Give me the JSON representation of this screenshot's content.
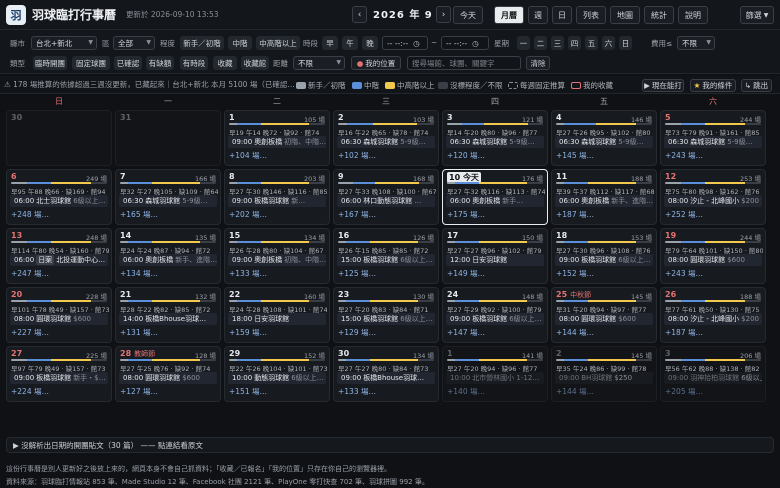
{
  "header": {
    "logo_text": "羽",
    "title": "羽球臨打行事曆",
    "updated": "更新於 2026-09-10 13:53",
    "prev_icon": "‹",
    "next_icon": "›",
    "month_label": "2026 年 9 月",
    "today_label": "今天",
    "views": [
      "月曆",
      "週",
      "日",
      "列表",
      "地圖",
      "統計",
      "說明"
    ],
    "active_view": "月曆",
    "filter_menu": "篩選"
  },
  "filters": {
    "county_label": "縣市",
    "county_value": "台北+新北",
    "district_label": "區",
    "district_value": "全部",
    "level_label": "程度",
    "levels": [
      "新手／初階",
      "中階",
      "中高階以上"
    ],
    "time_label": "時段",
    "times": [
      "早",
      "午",
      "晚"
    ],
    "time_from": "-- --:--",
    "time_to": "-- --:--",
    "week_label": "星期",
    "weekdays": [
      "一",
      "二",
      "三",
      "四",
      "五",
      "六",
      "日"
    ],
    "fee_label": "費用≤",
    "fee_value": "不限",
    "type_label": "類型",
    "types": [
      "臨時開團",
      "固定球團",
      "已確認",
      "有缺額",
      "有時段",
      "收藏",
      "收藏館"
    ],
    "distance_label": "距離",
    "distance_value": "不限",
    "my_location": "我的位置",
    "search_placeholder": "搜尋場館、球團、關鍵字",
    "clear": "清除"
  },
  "info": {
    "text": "⚠ 178 場推算的依據超過三週沒更新，已藏起來｜台北+新北 本月 5100 場（已確認…",
    "legend": [
      "新手／初階",
      "中階",
      "中高階以上",
      "沒標程度／不限",
      "每週固定推算",
      "我的收藏"
    ],
    "btn_now": "現在能打",
    "btn_mine": "我的條件",
    "btn_jump": "跳出"
  },
  "colors": {
    "beginner": "#9aa3ad",
    "mid": "#5b8fd9",
    "high": "#f2c94c",
    "unk": "#3a3e46",
    "red": "#e57373"
  },
  "weekdays": [
    "日",
    "一",
    "二",
    "三",
    "四",
    "五",
    "六"
  ],
  "cells": [
    {
      "day": "30",
      "pre": true
    },
    {
      "day": "31",
      "pre": true
    },
    {
      "day": "1",
      "count": "105 場",
      "meta": "早19 午14 晚72 · 缺92 · 館74",
      "time": "09:00",
      "name": "奧創板橋",
      "tag": "初階、中階…",
      "more": "+104 場…",
      "bar": [
        1,
        3,
        6,
        2
      ]
    },
    {
      "day": "2",
      "count": "103 場",
      "meta": "早16 午22 晚65 · 缺78 · 館74",
      "time": "06:30",
      "name": "森城羽球館",
      "tag": "5-9級…",
      "more": "+102 場…",
      "bar": [
        1,
        3,
        5,
        2
      ]
    },
    {
      "day": "3",
      "count": "121 場",
      "meta": "早14 午20 晚80 · 缺96 · 館77",
      "time": "06:30",
      "name": "森城羽球館",
      "tag": "5-9級…",
      "more": "+120 場…",
      "bar": [
        2,
        3,
        6,
        2
      ]
    },
    {
      "day": "4",
      "count": "146 場",
      "meta": "早27 午26 晚95 · 缺102 · 館80",
      "time": "06:30",
      "name": "森城羽球館",
      "tag": "5-9級…",
      "more": "+145 場…",
      "bar": [
        1,
        4,
        5,
        2
      ]
    },
    {
      "day": "5",
      "count": "244 場",
      "meta": "早73 午79 晚91 · 缺161 · 館85",
      "time": "06:30",
      "name": "森城羽球館",
      "tag": "5-9級…",
      "more": "+243 場…",
      "bar": [
        2,
        3,
        5,
        2
      ],
      "red": true
    },
    {
      "day": "6",
      "count": "249 場",
      "meta": "早95 午88 晚66 · 缺169 · 館94",
      "time": "06:00",
      "name": "北士羽球館",
      "tag": "6級以上…",
      "more": "+248 場…",
      "bar": [
        2,
        3,
        5,
        2
      ],
      "red": true
    },
    {
      "day": "7",
      "count": "166 場",
      "meta": "早32 午27 晚105 · 缺109 · 館64",
      "time": "06:30",
      "name": "森城羽球館",
      "tag": "5-9級…",
      "more": "+165 場…",
      "bar": [
        1,
        3,
        6,
        2
      ]
    },
    {
      "day": "8",
      "count": "203 場",
      "meta": "早27 午30 晚146 · 缺116 · 館85",
      "time": "09:00",
      "name": "板橋羽球館",
      "tag": "新…",
      "more": "+202 場…",
      "bar": [
        1,
        3,
        6,
        2
      ]
    },
    {
      "day": "9",
      "count": "168 場",
      "meta": "早27 午33 晚108 · 缺100 · 館67",
      "time": "06:00",
      "name": "林口動態羽球館",
      "tag": "…",
      "more": "+167 場…",
      "bar": [
        2,
        3,
        6,
        2
      ]
    },
    {
      "day": "10",
      "count": "176 場",
      "meta": "早27 午32 晚116 · 缺113 · 館74",
      "time": "06:00",
      "name": "奧創板橋",
      "tag": "新手…",
      "more": "+175 場…",
      "bar": [
        1,
        3,
        6,
        2
      ],
      "today": true
    },
    {
      "day": "11",
      "count": "188 場",
      "meta": "早39 午37 晚112 · 缺117 · 館68",
      "time": "06:00",
      "name": "奧創板橋",
      "tag": "新手、進階…",
      "more": "+187 場…",
      "bar": [
        1,
        3,
        6,
        2
      ]
    },
    {
      "day": "12",
      "count": "253 場",
      "meta": "早75 午80 晚98 · 缺162 · 館76",
      "time": "08:00",
      "name": "汐止 - 北峰國小",
      "tag": "$200",
      "more": "+252 場…",
      "bar": [
        2,
        3,
        5,
        2
      ],
      "red": true
    },
    {
      "day": "13",
      "count": "248 場",
      "meta": "早114 午80 晚54 · 缺160 · 館79",
      "time": "06:00",
      "pill": "日案",
      "name": "北投運動中心…",
      "tag": "",
      "more": "+247 場…",
      "bar": [
        2,
        3,
        5,
        2
      ],
      "red": true
    },
    {
      "day": "14",
      "count": "135 場",
      "meta": "早24 午24 晚87 · 缺94 · 館72",
      "time": "06:00",
      "name": "奧創板橋",
      "tag": "新手、進階…",
      "more": "+134 場…",
      "bar": [
        1,
        3,
        6,
        2
      ]
    },
    {
      "day": "15",
      "count": "134 場",
      "meta": "早26 午28 晚80 · 缺104 · 館67",
      "time": "09:00",
      "name": "奧創板橋",
      "tag": "初階、中階…",
      "more": "+133 場…",
      "bar": [
        1,
        3,
        6,
        2
      ]
    },
    {
      "day": "16",
      "count": "126 場",
      "meta": "早26 午15 晚85 · 缺85 · 館72",
      "time": "15:00",
      "name": "板橋羽球館",
      "tag": "6級以上…",
      "more": "+125 場…",
      "bar": [
        1,
        3,
        6,
        2
      ]
    },
    {
      "day": "17",
      "count": "150 場",
      "meta": "早27 午27 晚96 · 缺102 · 館79",
      "time": "12:00",
      "name": "日安羽球館",
      "tag": "",
      "more": "+149 場…",
      "bar": [
        1,
        3,
        6,
        2
      ]
    },
    {
      "day": "18",
      "count": "153 場",
      "meta": "早27 午30 晚96 · 缺108 · 館76",
      "time": "09:00",
      "name": "板橋羽球館",
      "tag": "6級以上…",
      "more": "+152 場…",
      "bar": [
        1,
        3,
        6,
        2
      ]
    },
    {
      "day": "19",
      "count": "244 場",
      "meta": "早79 午64 晚101 · 缺150 · 館80",
      "time": "08:00",
      "name": "圓環羽球館",
      "tag": "$600",
      "more": "+243 場…",
      "bar": [
        2,
        3,
        5,
        2
      ],
      "red": true
    },
    {
      "day": "20",
      "count": "228 場",
      "meta": "早101 午78 晚49 · 缺157 · 館73",
      "time": "08:00",
      "name": "圓環羽球館",
      "tag": "$600",
      "more": "+227 場…",
      "bar": [
        2,
        3,
        5,
        2
      ],
      "red": true
    },
    {
      "day": "21",
      "count": "132 場",
      "meta": "早28 午22 晚82 · 缺85 · 館72",
      "time": "14:00",
      "name": "板橋Bhouse羽球…",
      "tag": "",
      "more": "+131 場…",
      "bar": [
        1,
        3,
        6,
        2
      ]
    },
    {
      "day": "22",
      "count": "160 場",
      "meta": "早24 午28 晚108 · 缺101 · 館74",
      "time": "18:00",
      "name": "日安羽球館",
      "tag": "",
      "more": "+159 場…",
      "bar": [
        1,
        3,
        6,
        2
      ]
    },
    {
      "day": "23",
      "count": "130 場",
      "meta": "早27 午20 晚83 · 缺84 · 館71",
      "time": "15:00",
      "name": "板橋羽球館",
      "tag": "6級以上…",
      "more": "+129 場…",
      "bar": [
        1,
        3,
        6,
        2
      ]
    },
    {
      "day": "24",
      "count": "148 場",
      "meta": "早27 午29 晚92 · 缺100 · 館79",
      "time": "09:00",
      "name": "板橋羽球館",
      "tag": "6級以上…",
      "more": "+147 場…",
      "bar": [
        1,
        3,
        6,
        2
      ]
    },
    {
      "day": "25",
      "holiday": "中秋節",
      "count": "145 場",
      "meta": "早31 午20 晚94 · 缺97 · 館77",
      "time": "08:00",
      "name": "圓環羽球館",
      "tag": "$600",
      "more": "+144 場…",
      "bar": [
        1,
        3,
        6,
        2
      ],
      "red": true
    },
    {
      "day": "26",
      "count": "188 場",
      "meta": "早77 午61 晚50 · 缺130 · 館75",
      "time": "08:00",
      "name": "汐止 - 北峰國小",
      "tag": "$200",
      "more": "+187 場…",
      "bar": [
        2,
        3,
        5,
        2
      ],
      "red": true
    },
    {
      "day": "27",
      "count": "225 場",
      "meta": "早97 午79 晚49 · 缺157 · 館73",
      "time": "09:00",
      "name": "板橋羽球館",
      "tag": "新手・$…",
      "more": "+224 場…",
      "bar": [
        2,
        3,
        5,
        2
      ],
      "red": true
    },
    {
      "day": "28",
      "holiday": "教師節",
      "count": "128 場",
      "meta": "早27 午25 晚76 · 缺92 · 館74",
      "time": "08:00",
      "name": "圓環羽球館",
      "tag": "$600",
      "more": "+127 場…",
      "bar": [
        1,
        3,
        6,
        2
      ],
      "red": true
    },
    {
      "day": "29",
      "count": "152 場",
      "meta": "早22 午26 晚104 · 缺101 · 館73",
      "time": "10:00",
      "name": "動態羽球館",
      "tag": "6級以上…",
      "more": "+151 場…",
      "bar": [
        1,
        3,
        6,
        2
      ]
    },
    {
      "day": "30",
      "count": "134 場",
      "meta": "早27 午27 晚80 · 缺84 · 館73",
      "time": "09:00",
      "name": "板橋Bhouse羽球…",
      "tag": "",
      "more": "+133 場…",
      "bar": [
        1,
        3,
        6,
        2
      ]
    },
    {
      "day": "1",
      "count": "141 場",
      "meta": "早27 午20 晚94 · 缺96 · 館77",
      "time": "10:00",
      "name": "北市營林國小 1-12…",
      "tag": "",
      "more": "+140 場…",
      "bar": [
        1,
        3,
        6,
        2
      ],
      "post": true
    },
    {
      "day": "2",
      "count": "145 場",
      "meta": "早35 午24 晚86 · 缺99 · 館78",
      "time": "09:00",
      "name": "BH羽球館",
      "tag": "$250",
      "more": "+144 場…",
      "bar": [
        1,
        3,
        6,
        2
      ],
      "post": true
    },
    {
      "day": "3",
      "count": "206 場",
      "meta": "早56 午62 晚88 · 缺138 · 館82",
      "time": "09:00",
      "name": "羽神拾柏羽球館",
      "tag": "6級以上",
      "more": "+205 場…",
      "bar": [
        2,
        3,
        5,
        2
      ],
      "post": true,
      "red": true
    }
  ],
  "footer": {
    "unparsed": "▶ 沒解析出日期的開團貼文（30 篇） —— 點連結看原文",
    "disclaimer": "這份行事曆是別人更新好之後放上來的，網頁本身不會自己抓資料；「收藏／已報名」「我的位置」只存在你自己的瀏覽器裡。",
    "sources": "資料來源：羽球臨打情報站 853 筆、Made Studio 12 筆、Facebook 社團 2121 筆、PlayOne 零打快查 702 筆、羽球拼圖 992 筆。"
  }
}
